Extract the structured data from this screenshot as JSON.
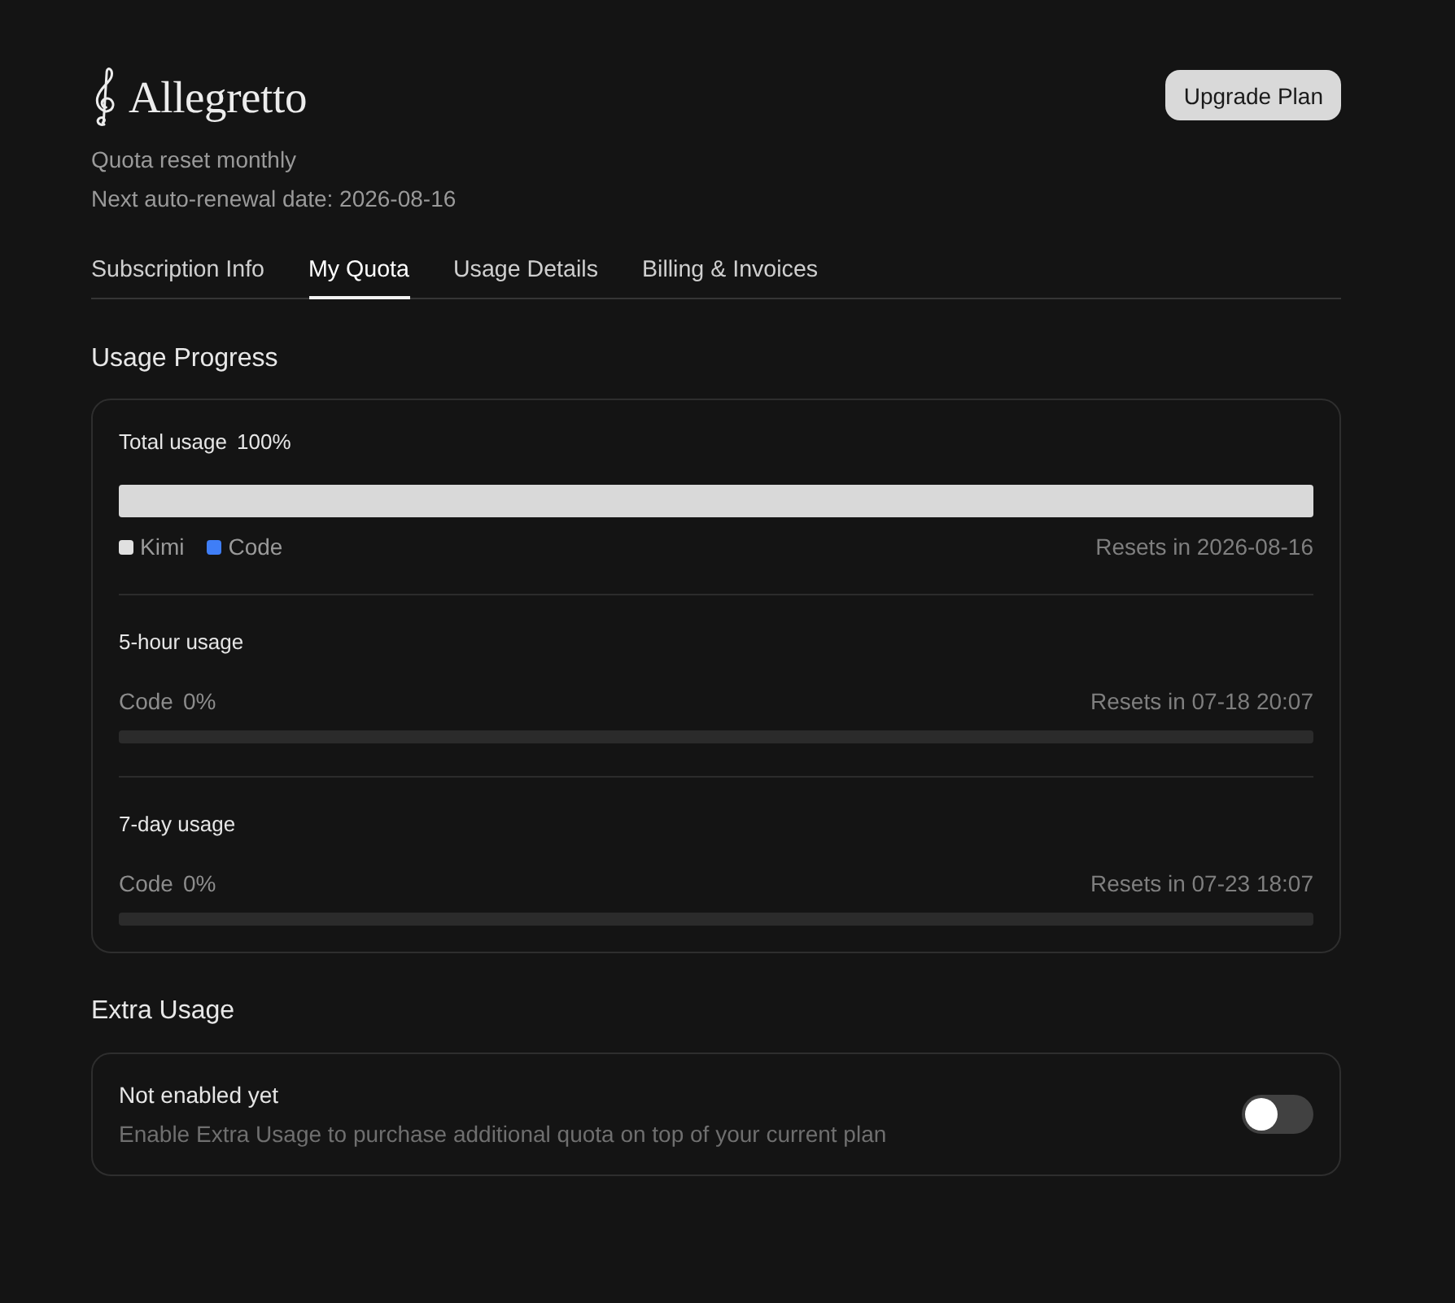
{
  "brand": {
    "name": "Allegretto"
  },
  "header": {
    "lines": [
      "Quota reset monthly",
      "Next auto-renewal date: 2026-08-16"
    ],
    "button": "Upgrade Plan"
  },
  "tabs": [
    {
      "label": "Subscription Info",
      "selected": false
    },
    {
      "label": "My Quota",
      "selected": true
    },
    {
      "label": "Usage Details",
      "selected": false
    },
    {
      "label": "Billing & Invoices",
      "selected": false
    }
  ],
  "usage_progress": {
    "title": "Usage Progress",
    "total": {
      "label": "Total usage",
      "percent": "100%",
      "level": 1,
      "legend": [
        {
          "label": "Kimi",
          "color": "#e0e0e0"
        },
        {
          "label": "Code",
          "color": "#3f7ef7"
        }
      ],
      "reset": "Resets in 2026-08-16"
    },
    "windows": [
      {
        "title": "5-hour usage",
        "label": "Code",
        "percent": "0%",
        "reset": "Resets in 07-18 20:07"
      },
      {
        "title": "7-day usage",
        "label": "Code",
        "percent": "0%",
        "reset": "Resets in 07-23 18:07"
      }
    ]
  },
  "extra_usage": {
    "title": "Extra Usage",
    "status": "Not enabled yet",
    "description": "Enable Extra Usage to purchase additional quota on top of your current plan",
    "on": false
  }
}
